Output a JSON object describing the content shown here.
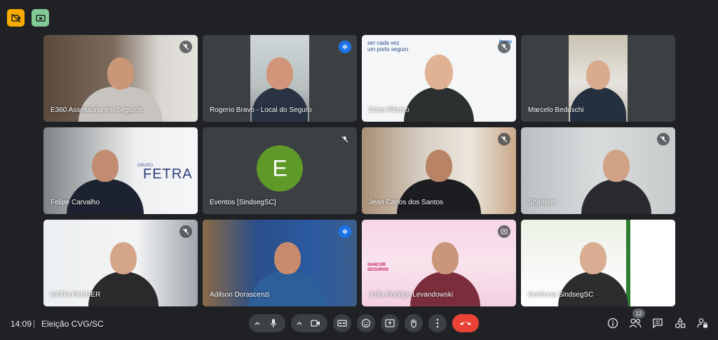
{
  "toolbar_top": {
    "icons": [
      "camera-off-icon",
      "share-screen-icon"
    ]
  },
  "participants": [
    {
      "name": "E360 Assessoria em Seguros",
      "status_icon": "mic-off-icon"
    },
    {
      "name": "Rogerio Bravo - Local do Seguro",
      "status_icon": "speaking-icon"
    },
    {
      "name": "Edna Ribeiro",
      "status_icon": "mic-off-icon",
      "background_text": "ser cada vez\num porto seguro",
      "brand": "Porto"
    },
    {
      "name": "Marcelo Beduschi",
      "status_icon": ""
    },
    {
      "name": "Felipe Carvalho",
      "status_icon": "",
      "background_text": "GRUPO",
      "brand": "FETRA"
    },
    {
      "name": "Eventos [SindsegSC]",
      "status_icon": "mic-off-icon",
      "avatar_letter": "E"
    },
    {
      "name": "Jean Carlos dos Santos",
      "status_icon": "mic-off-icon"
    },
    {
      "name": "Sharlene",
      "status_icon": "mic-off-icon"
    },
    {
      "name": "KATIA PACHER",
      "status_icon": "mic-off-icon"
    },
    {
      "name": "Adilson Dorascenzi",
      "status_icon": "speaking-icon"
    },
    {
      "name": "João Rodrigo Levandowski",
      "status_icon": "share-screen-icon",
      "brand": "SANCOR\nSEGUROS"
    },
    {
      "name": "Gerência SindsegSC",
      "status_icon": ""
    }
  ],
  "bottom_bar": {
    "time": "14:09",
    "separator": "|",
    "meeting_title": "Eleição CVG/SC",
    "participant_count": "12"
  },
  "colors": {
    "background": "#202124",
    "tile": "#3c4043",
    "end_call": "#ea4335",
    "speaking": "#1a73e8",
    "avatar": "#5f9a29"
  }
}
